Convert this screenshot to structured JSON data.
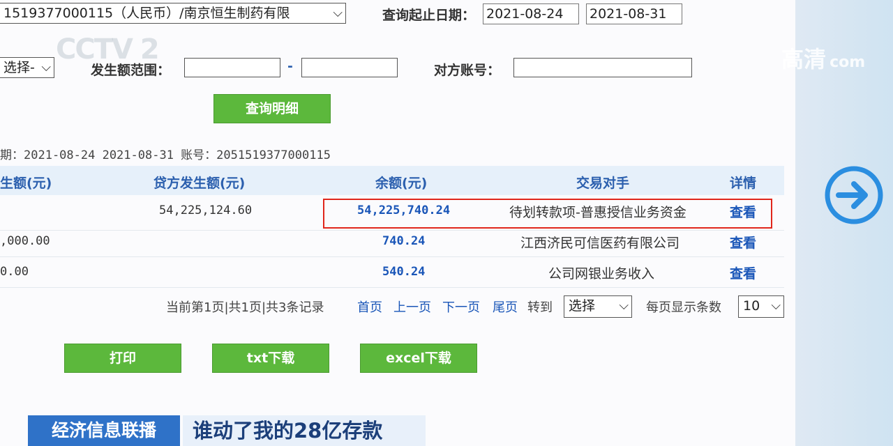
{
  "query": {
    "account_select_value": "1519377000115（人民币）/南京恒生制药有限",
    "date_range_label": "查询起止日期：",
    "start_date": "2021-08-24",
    "end_date": "2021-08-31",
    "type_select_value": "选择-",
    "amount_range_label": "发生额范围：",
    "range_dash": "-",
    "counterparty_account_label": "对方账号：",
    "query_button_label": "查询明细"
  },
  "summary_line": "期：2021-08-24 2021-08-31 账号：2051519377000115",
  "table": {
    "headers": [
      "生额(元)",
      "贷方发生额(元)",
      "余额(元)",
      "交易对手",
      "详情"
    ],
    "rows": [
      {
        "debit": "",
        "credit": "54,225,124.60",
        "balance": "54,225,740.24",
        "counterparty": "待划转款项-普惠授信业务资金",
        "detail": "查看",
        "highlighted": true
      },
      {
        "debit": ",000.00",
        "credit": "",
        "balance": "740.24",
        "counterparty": "江西济民可信医药有限公司",
        "detail": "查看",
        "highlighted": false
      },
      {
        "debit": "0.00",
        "credit": "",
        "balance": "540.24",
        "counterparty": "公司网银业务收入",
        "detail": "查看",
        "highlighted": false
      }
    ],
    "highlight_color": "#e0261b"
  },
  "pagination": {
    "status_text": "当前第1页|共1页|共3条记录",
    "first": "首页",
    "prev": "上一页",
    "next": "下一页",
    "last": "尾页",
    "goto_label": "转到",
    "goto_select": "选择",
    "per_page_label": "每页显示条数",
    "per_page_value": "10"
  },
  "actions": {
    "print": "打印",
    "txt": "txt下载",
    "excel": "excel下载"
  },
  "overlay": {
    "channel_logo": "CCTV 2",
    "hd_logo": "高清",
    "hd_logo_sub": "com",
    "banner_left": "经济信息联播",
    "banner_right": "谁动了我的28亿存款",
    "next_arrow_icon": "arrow-right-circle-icon"
  },
  "colors": {
    "accent_green": "#5cb83c",
    "link_blue": "#1a56b8",
    "header_bg": "#e6f0fa",
    "banner_blue": "#2f72c8"
  }
}
